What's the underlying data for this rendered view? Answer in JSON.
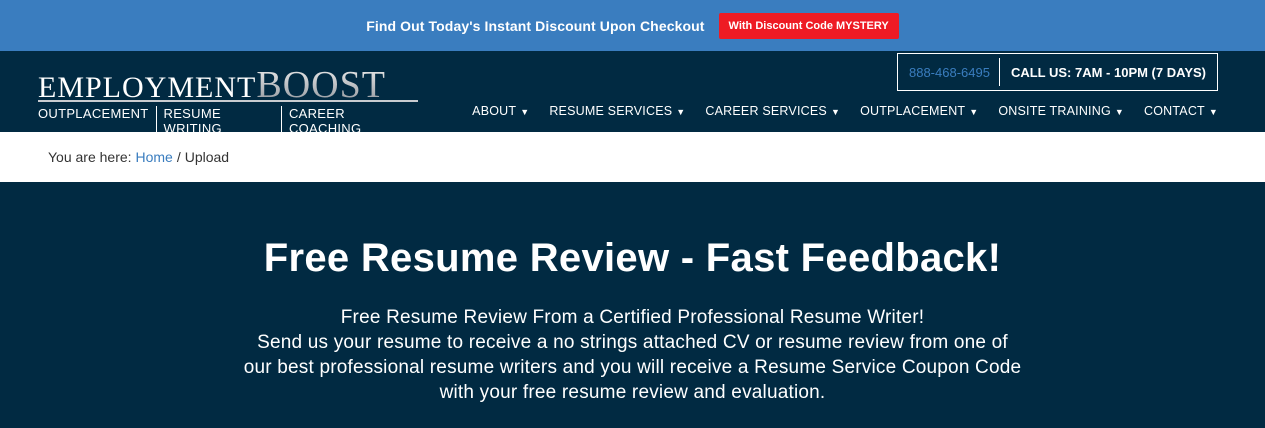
{
  "promo": {
    "text": "Find Out Today's Instant Discount Upon Checkout",
    "button": "With Discount Code MYSTERY"
  },
  "logo": {
    "word1": "EMPLOYMENT",
    "word2": "BOOST",
    "tags": [
      "OUTPLACEMENT",
      "RESUME WRITING",
      "CAREER COACHING"
    ]
  },
  "contact": {
    "phone": "888-468-6495",
    "hours": "CALL US: 7AM - 10PM (7 DAYS)"
  },
  "nav": {
    "items": [
      {
        "label": "ABOUT"
      },
      {
        "label": "RESUME SERVICES"
      },
      {
        "label": "CAREER SERVICES"
      },
      {
        "label": "OUTPLACEMENT"
      },
      {
        "label": "ONSITE TRAINING"
      },
      {
        "label": "CONTACT"
      }
    ],
    "caret": "▼"
  },
  "breadcrumb": {
    "prefix": "You are here:",
    "home": "Home",
    "separator": "/",
    "current": "Upload"
  },
  "hero": {
    "title": "Free Resume Review - Fast Feedback!",
    "lines": [
      "Free Resume Review From a Certified Professional Resume Writer!",
      "Send us your resume to receive a no strings attached CV or resume review from one of",
      "our best professional resume writers and you will receive a Resume Service Coupon Code",
      "with your free resume review and evaluation."
    ]
  },
  "colors": {
    "promo_bg": "#3a7dbf",
    "promo_button": "#ee1b24",
    "navy": "#012a42",
    "link": "#3a7dbf"
  }
}
